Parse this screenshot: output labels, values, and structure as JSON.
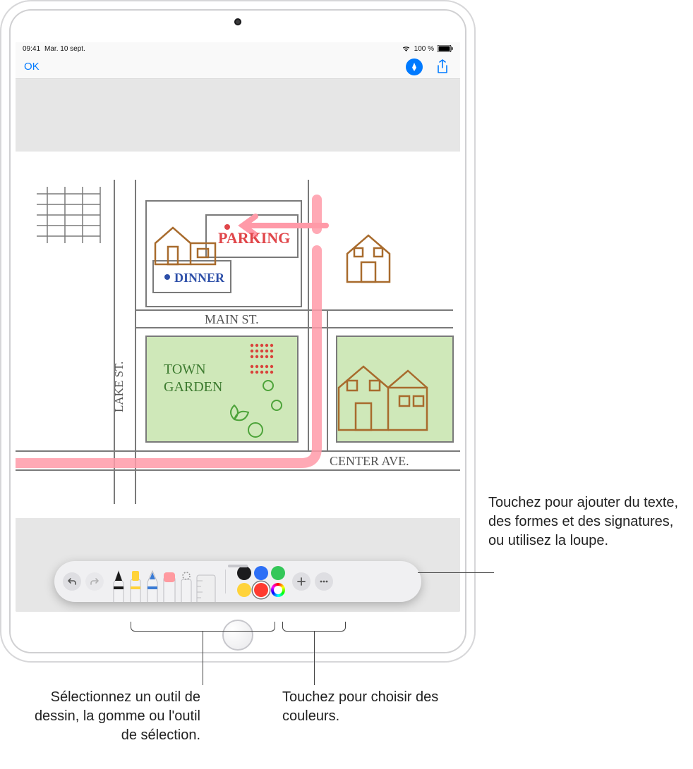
{
  "status": {
    "time": "09:41",
    "date": "Mar. 10 sept.",
    "battery_text": "100 %"
  },
  "nav": {
    "ok_label": "OK"
  },
  "drawing": {
    "parking": "PARKING",
    "dinner": "DINNER",
    "main_st": "MAIN ST.",
    "lake_st": "LAKE ST.",
    "town_garden_1": "TOWN",
    "town_garden_2": "GARDEN",
    "center_ave": "CENTER AVE."
  },
  "toolbar": {
    "tools": [
      {
        "name": "pen",
        "tip_color": "#1a1a1a"
      },
      {
        "name": "marker",
        "tip_color": "#ffd33a"
      },
      {
        "name": "pencil",
        "tip_color": "#3a7bd5"
      },
      {
        "name": "eraser",
        "tip_color": "#ff9aa0"
      },
      {
        "name": "lasso",
        "tip_color": "#a0a0a0"
      },
      {
        "name": "ruler",
        "tip_color": "#e0e0e0"
      }
    ],
    "colors": {
      "black": "#1c1c1e",
      "blue": "#2d6ff6",
      "green": "#34c759",
      "yellow": "#ffd33a",
      "red": "#ff3b30",
      "selected": "red"
    }
  },
  "callouts": {
    "add": "Touchez pour ajouter du texte, des formes et des signatures, ou utilisez la loupe.",
    "tools": "Sélectionnez un outil de dessin, la gomme ou l'outil de sélection.",
    "colors": "Touchez pour choisir des couleurs."
  }
}
